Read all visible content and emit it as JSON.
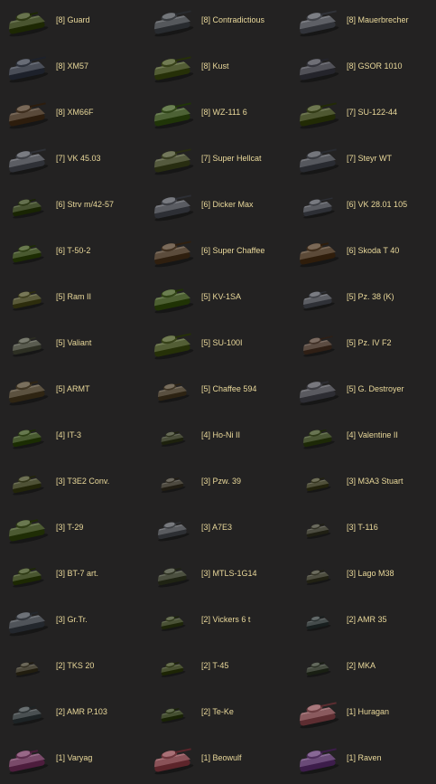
{
  "tanks": [
    {
      "tier": "[8]",
      "name": "Guard",
      "color": "#4a5530",
      "size": "l",
      "gun": "s"
    },
    {
      "tier": "[8]",
      "name": "Contradictious",
      "color": "#55585c",
      "size": "l",
      "gun": "l"
    },
    {
      "tier": "[8]",
      "name": "Mauerbrecher",
      "color": "#5e6066",
      "size": "l",
      "gun": "l"
    },
    {
      "tier": "[8]",
      "name": "XM57",
      "color": "#4a4e58",
      "size": "l",
      "gun": "l"
    },
    {
      "tier": "[8]",
      "name": "Kust",
      "color": "#535d35",
      "size": "l",
      "gun": "l"
    },
    {
      "tier": "[8]",
      "name": "GSOR 1010",
      "color": "#515158",
      "size": "l",
      "gun": "s"
    },
    {
      "tier": "[8]",
      "name": "XM66F",
      "color": "#5a4a3a",
      "size": "l",
      "gun": "l"
    },
    {
      "tier": "[8]",
      "name": "WZ-111 6",
      "color": "#4d6235",
      "size": "l",
      "gun": "l"
    },
    {
      "tier": "[7]",
      "name": "SU-122-44",
      "color": "#4f5832",
      "size": "l",
      "gun": "l"
    },
    {
      "tier": "[7]",
      "name": "VK 45.03",
      "color": "#5c5e64",
      "size": "l",
      "gun": "l"
    },
    {
      "tier": "[7]",
      "name": "Super Hellcat",
      "color": "#555a3e",
      "size": "l",
      "gun": "l"
    },
    {
      "tier": "[7]",
      "name": "Steyr WT",
      "color": "#56585e",
      "size": "l",
      "gun": "l"
    },
    {
      "tier": "[6]",
      "name": "Strv m/42-57",
      "color": "#465230",
      "size": "m",
      "gun": "s"
    },
    {
      "tier": "[6]",
      "name": "Dicker Max",
      "color": "#5a5c62",
      "size": "l",
      "gun": "l"
    },
    {
      "tier": "[6]",
      "name": "VK 28.01 105",
      "color": "#5a5c62",
      "size": "m",
      "gun": "l"
    },
    {
      "tier": "[6]",
      "name": "T-50-2",
      "color": "#4a5a30",
      "size": "m",
      "gun": "s"
    },
    {
      "tier": "[6]",
      "name": "Super Chaffee",
      "color": "#5c4c3c",
      "size": "l",
      "gun": "l"
    },
    {
      "tier": "[6]",
      "name": "Skoda T 40",
      "color": "#5c4a38",
      "size": "l",
      "gun": "s"
    },
    {
      "tier": "[5]",
      "name": "Ram II",
      "color": "#5a5a3a",
      "size": "m",
      "gun": "s"
    },
    {
      "tier": "[5]",
      "name": "KV-1SA",
      "color": "#4d6032",
      "size": "l",
      "gun": "s"
    },
    {
      "tier": "[5]",
      "name": "Pz. 38 (K)",
      "color": "#5c5e64",
      "size": "m",
      "gun": "s"
    },
    {
      "tier": "[5]",
      "name": "Valiant",
      "color": "#5a5c50",
      "size": "m",
      "gun": "s"
    },
    {
      "tier": "[5]",
      "name": "SU-100I",
      "color": "#535e35",
      "size": "l",
      "gun": "l"
    },
    {
      "tier": "[5]",
      "name": "Pz. IV F2",
      "color": "#5c4c42",
      "size": "m",
      "gun": "l"
    },
    {
      "tier": "[5]",
      "name": "ARMT",
      "color": "#5c5240",
      "size": "l",
      "gun": "s"
    },
    {
      "tier": "[5]",
      "name": "Chaffee 594",
      "color": "#5a5040",
      "size": "m",
      "gun": "s"
    },
    {
      "tier": "[5]",
      "name": "G. Destroyer",
      "color": "#5a5a60",
      "size": "l",
      "gun": "s"
    },
    {
      "tier": "[4]",
      "name": "IT-3",
      "color": "#485a30",
      "size": "m",
      "gun": "s"
    },
    {
      "tier": "[4]",
      "name": "Ho-Ni II",
      "color": "#4a4e3a",
      "size": "s",
      "gun": "s"
    },
    {
      "tier": "[4]",
      "name": "Valentine II",
      "color": "#4a5634",
      "size": "m",
      "gun": "s"
    },
    {
      "tier": "[3]",
      "name": "T3E2 Conv.",
      "color": "#4f5236",
      "size": "m",
      "gun": "s"
    },
    {
      "tier": "[3]",
      "name": "Pzw. 39",
      "color": "#4e4a40",
      "size": "s",
      "gun": "s"
    },
    {
      "tier": "[3]",
      "name": "M3A3 Stuart",
      "color": "#50503a",
      "size": "s",
      "gun": "s"
    },
    {
      "tier": "[3]",
      "name": "T-29",
      "color": "#4c5a32",
      "size": "l",
      "gun": "s"
    },
    {
      "tier": "[3]",
      "name": "A7E3",
      "color": "#5a5c60",
      "size": "m",
      "gun": "s"
    },
    {
      "tier": "[3]",
      "name": "T-116",
      "color": "#4c4c40",
      "size": "s",
      "gun": "s"
    },
    {
      "tier": "[3]",
      "name": "BT-7 art.",
      "color": "#4a5630",
      "size": "m",
      "gun": "s"
    },
    {
      "tier": "[3]",
      "name": "MTLS-1G14",
      "color": "#4c5040",
      "size": "m",
      "gun": "s"
    },
    {
      "tier": "[3]",
      "name": "Lago M38",
      "color": "#4e4e40",
      "size": "s",
      "gun": "s"
    },
    {
      "tier": "[3]",
      "name": "Gr.Tr.",
      "color": "#50545a",
      "size": "l",
      "gun": "s"
    },
    {
      "tier": "[2]",
      "name": "Vickers 6 t",
      "color": "#4a5236",
      "size": "s",
      "gun": "s"
    },
    {
      "tier": "[2]",
      "name": "AMR 35",
      "color": "#454c4c",
      "size": "s",
      "gun": "s"
    },
    {
      "tier": "[2]",
      "name": "TKS 20",
      "color": "#4e4a3c",
      "size": "s",
      "gun": "s"
    },
    {
      "tier": "[2]",
      "name": "T-45",
      "color": "#4a5232",
      "size": "s",
      "gun": "s"
    },
    {
      "tier": "[2]",
      "name": "MKA",
      "color": "#464c40",
      "size": "s",
      "gun": "s"
    },
    {
      "tier": "[2]",
      "name": "AMR P.103",
      "color": "#4a5052",
      "size": "m",
      "gun": "s"
    },
    {
      "tier": "[2]",
      "name": "Te-Ke",
      "color": "#465032",
      "size": "s",
      "gun": "s"
    },
    {
      "tier": "[1]",
      "name": "Huragan",
      "color": "#8a5a5e",
      "size": "l",
      "gun": "l"
    },
    {
      "tier": "[1]",
      "name": "Varyag",
      "color": "#7a4a6a",
      "size": "l",
      "gun": "s"
    },
    {
      "tier": "[1]",
      "name": "Beowulf",
      "color": "#8a5258",
      "size": "l",
      "gun": "l"
    },
    {
      "tier": "[1]",
      "name": "Raven",
      "color": "#6a4a78",
      "size": "l",
      "gun": "l"
    }
  ]
}
